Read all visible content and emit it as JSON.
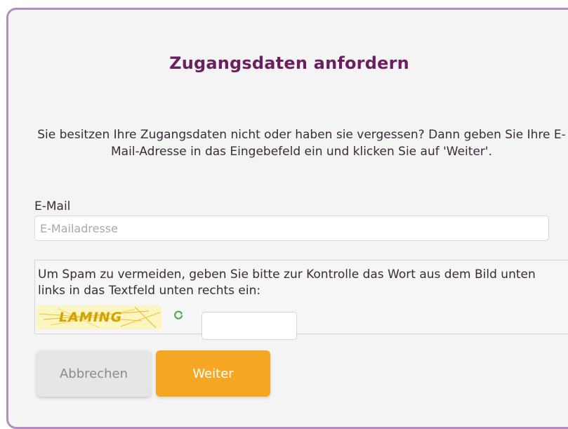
{
  "dialog": {
    "title": "Zugangsdaten anfordern",
    "description": "Sie besitzen Ihre Zugangsdaten nicht oder haben sie vergessen? Dann geben Sie Ihre E-Mail-Adresse in das Eingebefeld ein und klicken Sie auf 'Weiter'."
  },
  "email": {
    "label": "E-Mail",
    "placeholder": "E-Mailadresse",
    "value": ""
  },
  "captcha": {
    "instruction": "Um Spam zu vermeiden, geben Sie bitte zur Kontrolle das Wort aus dem Bild unten links in das Textfeld unten rechts ein:",
    "image_word": "LAMING",
    "refresh_icon": "refresh-icon",
    "input_value": ""
  },
  "buttons": {
    "cancel_label": "Abbrechen",
    "next_label": "Weiter"
  },
  "colors": {
    "title": "#6b1f5f",
    "border": "#b48cc0",
    "primary_button": "#f5a623",
    "secondary_button": "#e6e6e6",
    "refresh_icon": "#4caf50",
    "captcha_background": "#fbf5c2"
  }
}
